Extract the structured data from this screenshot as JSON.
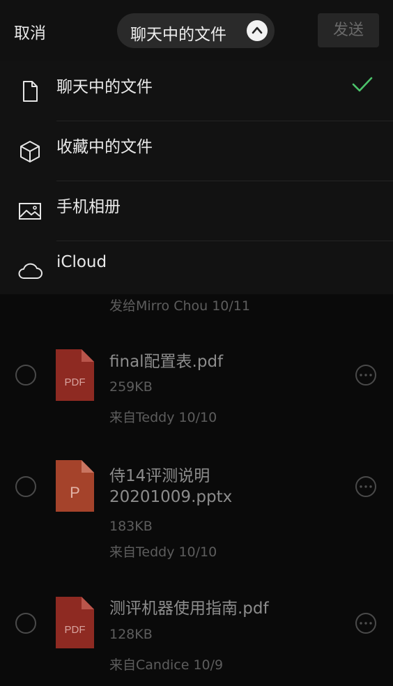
{
  "header": {
    "cancel_label": "取消",
    "title": "聊天中的文件",
    "send_label": "发送"
  },
  "menu": {
    "items": [
      {
        "label": "聊天中的文件",
        "icon": "document-icon",
        "selected": true
      },
      {
        "label": "收藏中的文件",
        "icon": "cube-icon",
        "selected": false
      },
      {
        "label": "手机相册",
        "icon": "image-icon",
        "selected": false
      },
      {
        "label": "iCloud",
        "icon": "cloud-icon",
        "selected": false
      }
    ]
  },
  "files": {
    "partial_from": "发给Mirro Chou 10/11",
    "items": [
      {
        "name": "final配置表.pdf",
        "size": "259KB",
        "from": "来自Teddy 10/10",
        "type": "PDF",
        "color": "#8e2a22"
      },
      {
        "name": "侍14评测说明20201009.pptx",
        "name_line1": "侍14评测说明",
        "name_line2": "20201009.pptx",
        "size": "183KB",
        "from": "来自Teddy 10/10",
        "type": "P",
        "color": "#a5432b"
      },
      {
        "name": "测评机器使用指南.pdf",
        "size": "128KB",
        "from": "来自Candice 10/9",
        "type": "PDF",
        "color": "#8e2a22"
      }
    ]
  },
  "colors": {
    "check": "#4cc36b",
    "pdf": "#8e2a22",
    "ppt": "#a5432b"
  }
}
